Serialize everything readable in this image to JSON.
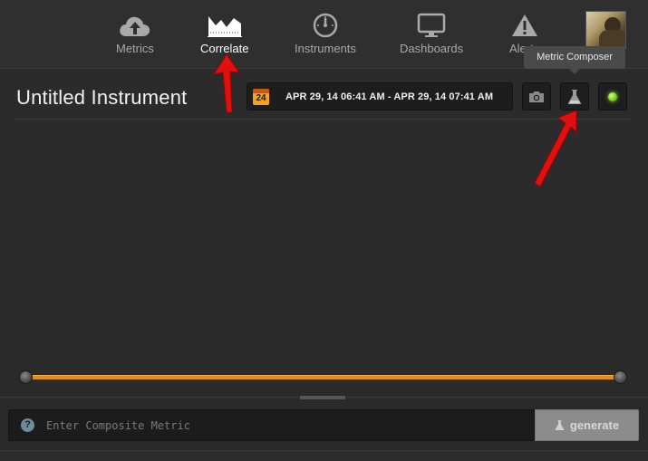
{
  "nav": {
    "items": [
      {
        "label": "Metrics",
        "icon": "cloud-upload-icon"
      },
      {
        "label": "Correlate",
        "icon": "area-chart-icon",
        "active": true
      },
      {
        "label": "Instruments",
        "icon": "gauge-icon"
      },
      {
        "label": "Dashboards",
        "icon": "monitor-icon"
      },
      {
        "label": "Alerts",
        "icon": "warning-icon"
      }
    ]
  },
  "tooltip": {
    "text": "Metric Composer"
  },
  "instrument": {
    "title": "Untitled Instrument",
    "calendar_day": "24",
    "date_range": "APR 29, 14 06:41 AM - APR 29, 14 07:41 AM"
  },
  "composer": {
    "help": "?",
    "placeholder": "Enter Composite Metric",
    "generate_label": "generate"
  },
  "colors": {
    "accent_orange": "#e38a22",
    "status_green": "#7ad12a",
    "annotation_red": "#e01010"
  }
}
